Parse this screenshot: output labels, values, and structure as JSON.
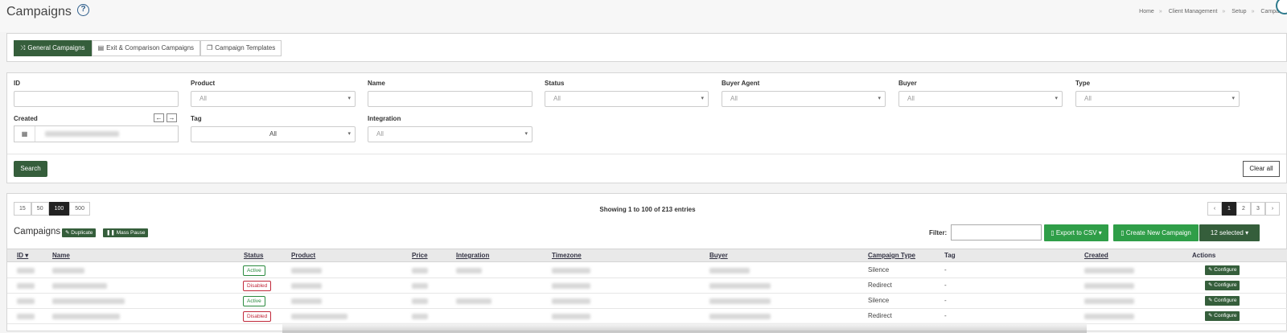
{
  "page": {
    "title": "Campaigns"
  },
  "breadcrumb": [
    "Home",
    "Client Management",
    "Setup",
    "Campa"
  ],
  "tabs": [
    {
      "icon": "shuffle-icon",
      "label": "General Campaigns",
      "active": true
    },
    {
      "icon": "document-icon",
      "label": "Exit & Comparison Campaigns",
      "active": false
    },
    {
      "icon": "copy-icon",
      "label": "Campaign Templates",
      "active": false
    }
  ],
  "filters": {
    "id_label": "ID",
    "product_label": "Product",
    "product_value": "All",
    "name_label": "Name",
    "status_label": "Status",
    "status_value": "All",
    "buyer_agent_label": "Buyer Agent",
    "buyer_agent_value": "All",
    "buyer_label": "Buyer",
    "buyer_value": "All",
    "type_label": "Type",
    "type_value": "All",
    "created_label": "Created",
    "tag_label": "Tag",
    "tag_value": "All",
    "integration_label": "Integration",
    "integration_value": "All",
    "search_button": "Search",
    "clear_button": "Clear all"
  },
  "table_controls": {
    "page_sizes": [
      "15",
      "50",
      "100",
      "500"
    ],
    "active_page_size": "100",
    "showing": "Showing 1 to 100 of 213 entries",
    "pages": [
      "‹",
      "1",
      "2",
      "3",
      "›"
    ],
    "active_page": "1"
  },
  "campaigns": {
    "title": "Campaigns",
    "duplicate_label": "Duplicate",
    "mass_pause_label": "Mass Pause",
    "filter_label": "Filter:",
    "export_label": "Export to CSV ▾",
    "create_label": "Create New Campaign",
    "selected_label": "12 selected ▾"
  },
  "columns": {
    "id": "ID ▾",
    "name": "Name",
    "status": "Status",
    "product": "Product",
    "price": "Price",
    "integration": "Integration",
    "timezone": "Timezone",
    "buyer": "Buyer",
    "campaign_type": "Campaign Type",
    "tag": "Tag",
    "created": "Created",
    "actions": "Actions"
  },
  "rows": [
    {
      "status": "Active",
      "campaign_type": "Silence",
      "tag": "-",
      "action": "Configure"
    },
    {
      "status": "Disabled",
      "campaign_type": "Redirect",
      "tag": "-",
      "action": "Configure"
    },
    {
      "status": "Active",
      "campaign_type": "Silence",
      "tag": "-",
      "action": "Configure"
    },
    {
      "status": "Disabled",
      "campaign_type": "Redirect",
      "tag": "-",
      "action": "Configure"
    }
  ],
  "colors": {
    "brand_green": "#355e3b",
    "action_green": "#2f9e48",
    "active": "#2a8a3e",
    "disabled": "#c0283a"
  }
}
